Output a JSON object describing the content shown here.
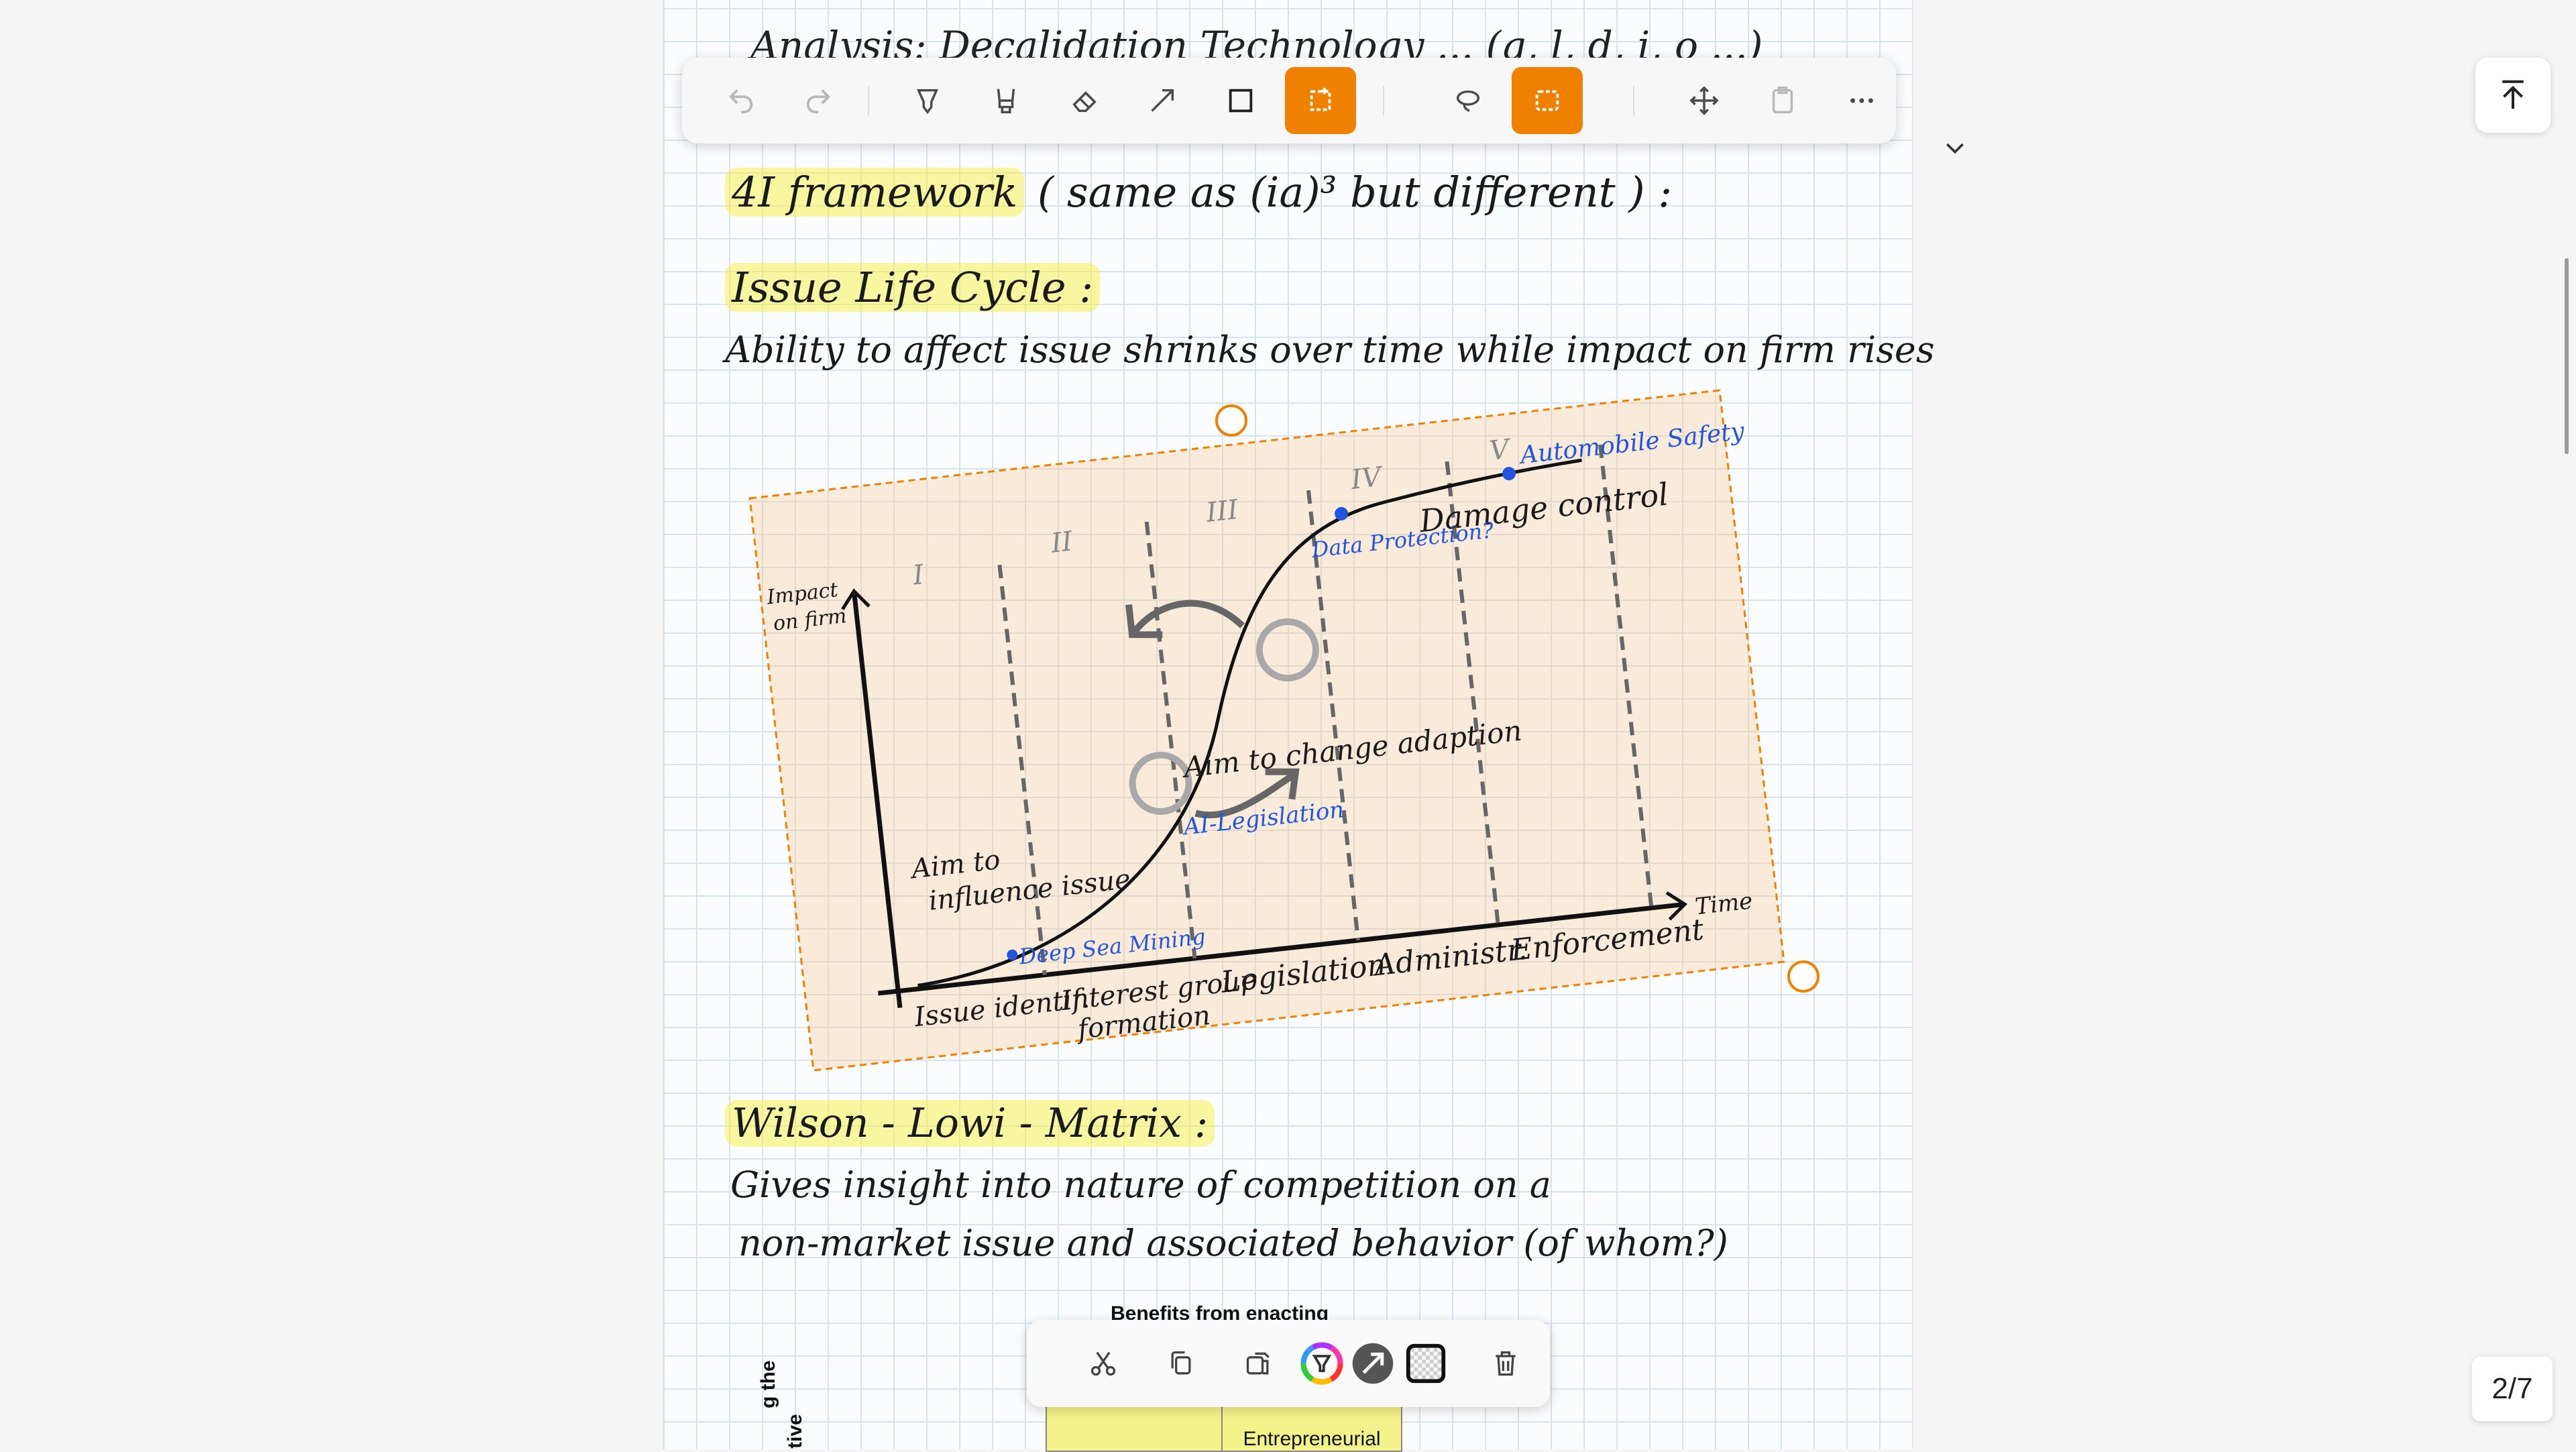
{
  "toolbar": {
    "undo": "undo-icon",
    "redo": "redo-icon",
    "pen": "pen-icon",
    "highlighter": "highlighter-icon",
    "eraser": "eraser-icon",
    "line": "line-icon",
    "shape": "square-icon",
    "shape_select": "shape-select-icon",
    "lasso": "lasso-icon",
    "rect_select": "rect-select-icon",
    "move": "move-icon",
    "paste": "paste-icon",
    "more": "more-icon",
    "accent": "#f08000"
  },
  "notes": {
    "header_fragment": "Analysis: Decalidation Technology ... (g, l, d, i, o ...)",
    "framework": "4I framework",
    "framework_rest": "( same as (ia)³ but different ) :",
    "ilc_title": "Issue Life Cycle :",
    "ilc_desc": "Ability to affect issue shrinks over time while impact on firm rises",
    "wl_title": "Wilson - Lowi - Matrix :",
    "wl_desc1": "Gives insight into nature of competition on a",
    "wl_desc2": "non-market issue and associated behavior (of whom?)"
  },
  "diagram": {
    "y_label_1": "Impact",
    "y_label_2": "on firm",
    "x_label": "Time",
    "phases": [
      "I",
      "II",
      "III",
      "IV",
      "V"
    ],
    "stages": [
      "Issue identif.",
      "Interest group",
      "formation",
      "Legislation",
      "Administr.",
      "Enforcement"
    ],
    "note_influence_1": "Aim to",
    "note_influence_2": "influence issue",
    "note_adaption": "Aim to change adaption",
    "damage_control": "Damage control",
    "points": [
      "Deep Sea Mining",
      "AI-Legislation",
      "Data Protection?",
      "Automobile Safety"
    ],
    "point_color": "#2255dd"
  },
  "matrix": {
    "header": "Benefits from enacting",
    "side_1": "g the",
    "side_2": "tive",
    "cell": "Entrepreneurial"
  },
  "context": {
    "cut": "cut-icon",
    "copy": "copy-icon",
    "duplicate": "duplicate-icon",
    "color": "color-wheel-icon",
    "style": "arrow-style-icon",
    "fill": "transparent-fill-icon",
    "delete": "trash-icon"
  },
  "page_indicator": "2/7"
}
